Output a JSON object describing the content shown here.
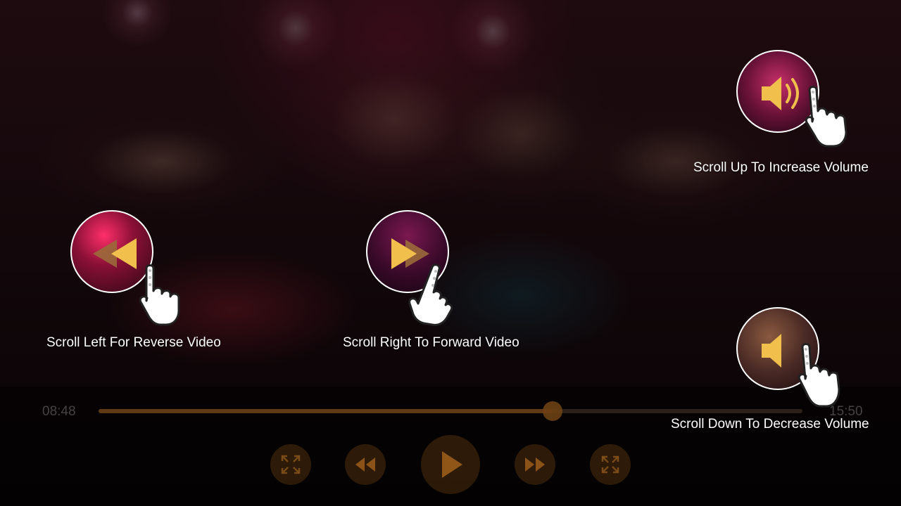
{
  "player": {
    "current_time": "08:48",
    "total_time": "15:50",
    "progress": 0.645
  },
  "controls": {
    "buttons": [
      "fullscreen-icon",
      "rewind-icon",
      "play-icon",
      "forward-icon",
      "expand-icon"
    ]
  },
  "hints": {
    "reverse": "Scroll Left For  Reverse Video",
    "forward": "Scroll Right To Forward Video",
    "volume_up": "Scroll Up To Increase Volume",
    "volume_down": "Scroll Down To Decrease Volume"
  },
  "colors": {
    "accent": "#f0bf4c",
    "control_tint": "#6e4114"
  }
}
